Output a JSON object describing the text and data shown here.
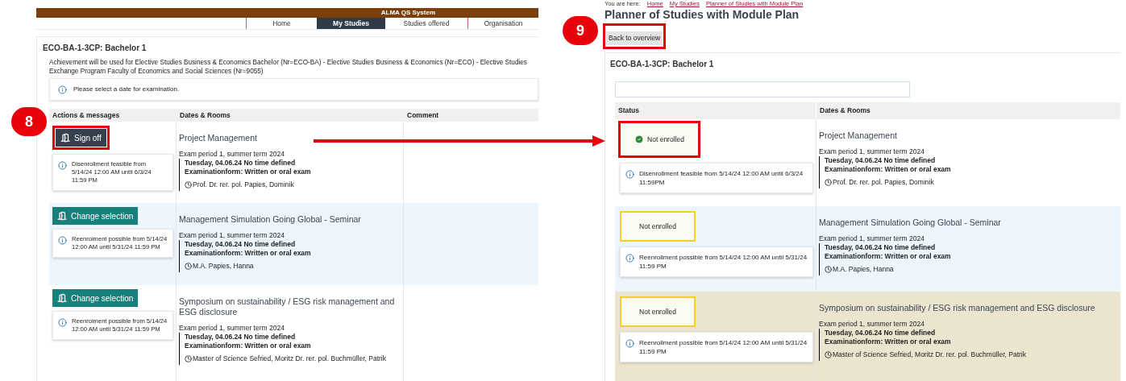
{
  "left_panel": {
    "header": {
      "title": "ALMA QS System"
    },
    "nav": [
      {
        "label": "Home",
        "selected": false
      },
      {
        "label": "My Studies",
        "selected": true
      },
      {
        "label": "Studies offered",
        "selected": false
      },
      {
        "label": "Organisation",
        "selected": false
      }
    ],
    "heading": "ECO-BA-1-3CP: Bachelor 1",
    "description": "Achievement will be used for Elective Studies Business & Economics Bachelor (Nr=ECO-BA) - Elective Studies Business & Economics (Nr=ECO) - Elective Studies Exchange Program Faculty of Economics and Social Sciences (Nr=9055)",
    "info": "Please select a date for examination.",
    "columns": [
      "Actions & messages",
      "Dates & Rooms",
      "Comment"
    ],
    "rows": [
      {
        "action": {
          "label": "Sign off",
          "kind": "sign_off",
          "highlighted": true
        },
        "message": "Disenrollment feasible from 5/14/24 12:00 AM until 6/3/24 11:59 PM",
        "color": "#ffffff",
        "title": "Project Management",
        "period": "Exam period 1, summer term 2024",
        "date": "Tuesday, 04.06.24 No time defined",
        "form": "Examinationform: Written or oral exam",
        "lecturer": "Prof. Dr. rer. pol. Papies, Dominik"
      },
      {
        "action": {
          "label": "Change selection",
          "kind": "change",
          "highlighted": false
        },
        "message": "Reenrolment possible from 5/14/24 12:00 AM until 5/31/24 11:59 PM",
        "color": "#eef6fd",
        "title": "Management Simulation Going Global - Seminar",
        "period": "Exam period 1, summer term 2024",
        "date": "Tuesday, 04.06.24 No time defined",
        "form": "Examinationform: Written or oral exam",
        "lecturer": "M.A. Papies, Hanna"
      },
      {
        "action": {
          "label": "Change selection",
          "kind": "change",
          "highlighted": false
        },
        "message": "Reenrolment possible from 5/14/24 12:00 AM until 5/31/24 11:59 PM",
        "color": "#ffffff",
        "title": "Symposium on sustainability / ESG risk management and ESG disclosure",
        "period": "Exam period 1, summer term 2024",
        "date": "Tuesday, 04.06.24 No time defined",
        "form": "Examinationform: Written or oral exam",
        "lecturer": "Master of Science Sefried, Moritz Dr. rer. pol. Buchmüller, Patrik"
      }
    ]
  },
  "right_panel": {
    "breadcrumb": {
      "label": "You are here:",
      "items": [
        "Home",
        "My Studies",
        "Planner of Studies with Module Plan"
      ]
    },
    "title": "Planner of Studies with Module Plan",
    "back_button": {
      "label": "Back to overview",
      "highlighted": true
    },
    "heading": "ECO-BA-1-3CP: Bachelor 1",
    "columns": [
      "Status",
      "Dates & Rooms"
    ],
    "rows": [
      {
        "status": {
          "label": "Not enrolled",
          "checked": true,
          "highlighted": true
        },
        "message": "Disenrollment feasible from 5/14/24 12:00 AM until 6/3/24 11:59PM",
        "color": "#ffffff",
        "title": "Project Management",
        "period": "Exam period 1, summer term 2024",
        "date": "Tuesday, 04.06.24 No time defined",
        "form": "Examinationform: Written or oral exam",
        "lecturer": "Prof. Dr. rer. pol. Papies, Dominik"
      },
      {
        "status": {
          "label": "Not enrolled",
          "checked": false,
          "highlighted": false
        },
        "message": "Reenrollment possible from 5/14/24 12:00 AM until 5/31/24 11:59 PM",
        "color": "#eef6fd",
        "title": "Management Simulation Going Global - Seminar",
        "period": "Exam period 1, summer term 2024",
        "date": "Tuesday, 04.06.24 No time defined",
        "form": "Examinationform: Written or oral exam",
        "lecturer": "M.A. Papies, Hanna"
      },
      {
        "status": {
          "label": "Not enrolled",
          "checked": false,
          "highlighted": false
        },
        "message": "Reenrollment possible from 5/14/24 12:00 AM until 5/31/24 11:59 PM",
        "color": "#ebe5d0",
        "title": "Symposium on sustainability / ESG risk management and ESG disclosure",
        "period": "Exam period 1, summer term 2024",
        "date": "Tuesday, 04.06.24 No time defined",
        "form": "Examinationform: Written or oral exam",
        "lecturer": "Master of Science Sefried, Moritz Dr. rer. pol. Buchmüller, Patrik"
      }
    ]
  },
  "callouts": [
    {
      "number": "8"
    },
    {
      "number": "9"
    }
  ]
}
